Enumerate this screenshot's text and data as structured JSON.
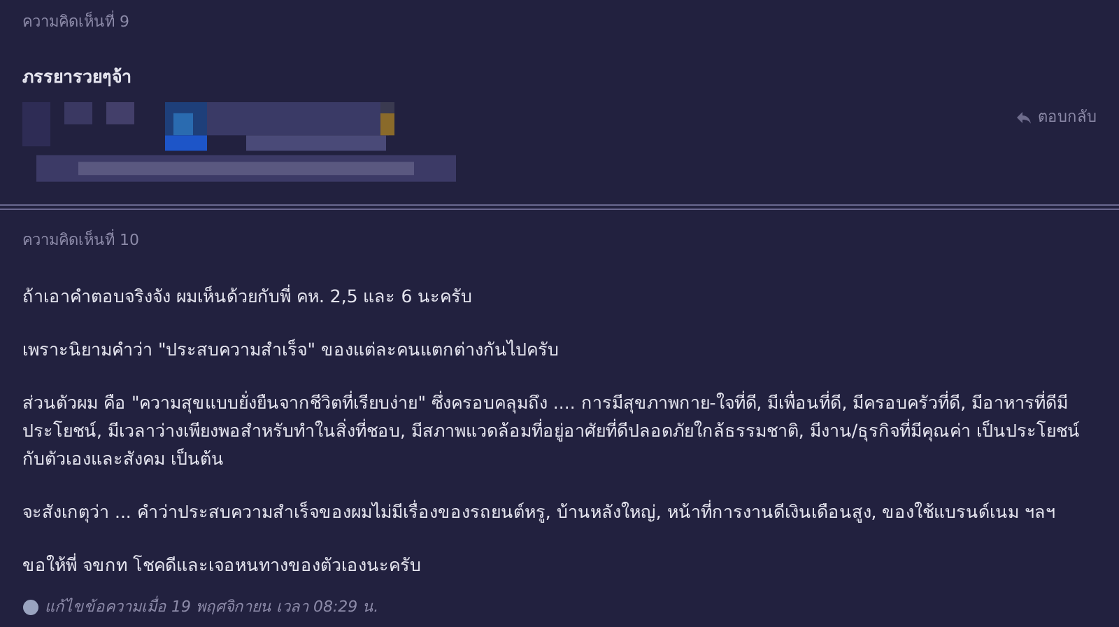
{
  "comments": [
    {
      "label": "ความคิดเห็นที่ 9",
      "paragraphs": [
        "ภรรยารวยๆจ้า"
      ],
      "bold": true,
      "signature": {
        "kind": "picture"
      },
      "reply": "ตอบกลับ"
    },
    {
      "label": "ความคิดเห็นที่ 10",
      "paragraphs": [
        "ถ้าเอาคำตอบจริงจัง ผมเห็นด้วยกับพี่ คห. 2,5 และ 6 นะครับ",
        "เพราะนิยามคำว่า \"ประสบความสำเร็จ\" ของแต่ละคนแตกต่างกันไปครับ",
        "ส่วนตัวผม คือ \"ความสุขแบบยั่งยืนจากชีวิตที่เรียบง่าย\" ซึ่งครอบคลุมถึง .... การมีสุขภาพกาย-ใจที่ดี, มีเพื่อนที่ดี, มีครอบครัวที่ดี, มีอาหารที่ดีมีประโยชน์, มีเวลาว่างเพียงพอสำหรับทำในสิ่งที่ชอบ, มีสภาพแวดล้อมที่อยู่อาศัยที่ดีปลอดภัยใกล้ธรรมชาติ, มีงาน/ธุรกิจที่มีคุณค่า เป็นประโยชน์กับตัวเองและสังคม เป็นต้น",
        "จะสังเกตุว่า ... คำว่าประสบความสำเร็จของผมไม่มีเรื่องของรถยนต์หรู, บ้านหลังใหญ่, หน้าที่การงานดีเงินเดือนสูง, ของใช้แบรนด์เนม ฯลฯ",
        "ขอให้พี่ จขกท โชคดีและเจอหนทางของตัวเองนะครับ"
      ],
      "bold": false,
      "edited": "แก้ไขข้อความเมื่อ 19 พฤศจิกายน เวลา 08:29 น."
    }
  ]
}
